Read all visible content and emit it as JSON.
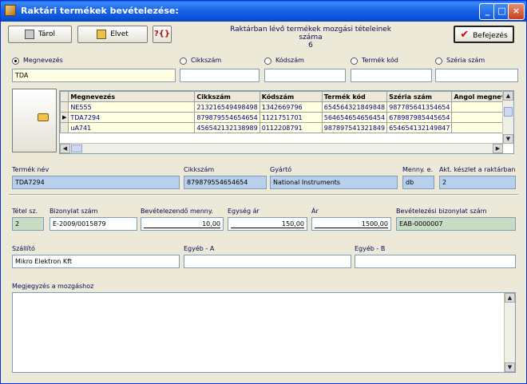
{
  "window": {
    "title": "Raktári termékek bevételezése:"
  },
  "toolbar": {
    "save_label": "Tárol",
    "cancel_label": "Elvet",
    "help_label": "?{}",
    "finish_label": "Befejezés"
  },
  "movement": {
    "label": "Raktárban lévő termékek mozgási tételeinek száma",
    "count": "6"
  },
  "search": {
    "options": [
      "Megnevezés",
      "Cikkszám",
      "Kódszám",
      "Termék kód",
      "Széria szám"
    ],
    "selected": "Megnevezés",
    "value": "TDA"
  },
  "grid": {
    "columns": [
      "Megnevezés",
      "Cikkszám",
      "Kódszám",
      "Termék kód",
      "Széria szám",
      "Angol megnev"
    ],
    "rows": [
      [
        "NE555",
        "213216549498498",
        "1342669796",
        "654564321849848",
        "987785641354654",
        ""
      ],
      [
        "TDA7294",
        "879879554654654",
        "1121751701",
        "564654654656454",
        "678987985445654",
        ""
      ],
      [
        "uA741",
        "456542132138989",
        "0112208791",
        "987897541321849",
        "654654132149847",
        ""
      ]
    ],
    "current_row": 1
  },
  "product": {
    "name_label": "Termék név",
    "name": "TDA7294",
    "sku_label": "Cikkszám",
    "sku": "879879554654654",
    "maker_label": "Gyártó",
    "maker": "National Instruments",
    "unit_label": "Menny. e.",
    "unit": "db",
    "stock_label": "Akt. készlet a raktárban",
    "stock": "2"
  },
  "receipt": {
    "item_no_label": "Tétel sz.",
    "item_no": "2",
    "doc_no_label": "Bizonylat szám",
    "doc_no": "E-2009/0015879",
    "qty_label": "Bevételezendő menny.",
    "qty": "10,00",
    "unit_price_label": "Egység ár",
    "unit_price": "150,00",
    "price_label": "Ár",
    "price": "1500,00",
    "receipt_doc_label": "Bevételezési bizonylat szám",
    "receipt_doc": "EAB-0000007"
  },
  "supplier": {
    "supplier_label": "Szállító",
    "supplier": "Mikro Elektron Kft",
    "other_a_label": "Egyéb - A",
    "other_a": "",
    "other_b_label": "Egyéb - B",
    "other_b": ""
  },
  "notes": {
    "label": "Megjegyzés a mozgáshoz",
    "value": ""
  }
}
